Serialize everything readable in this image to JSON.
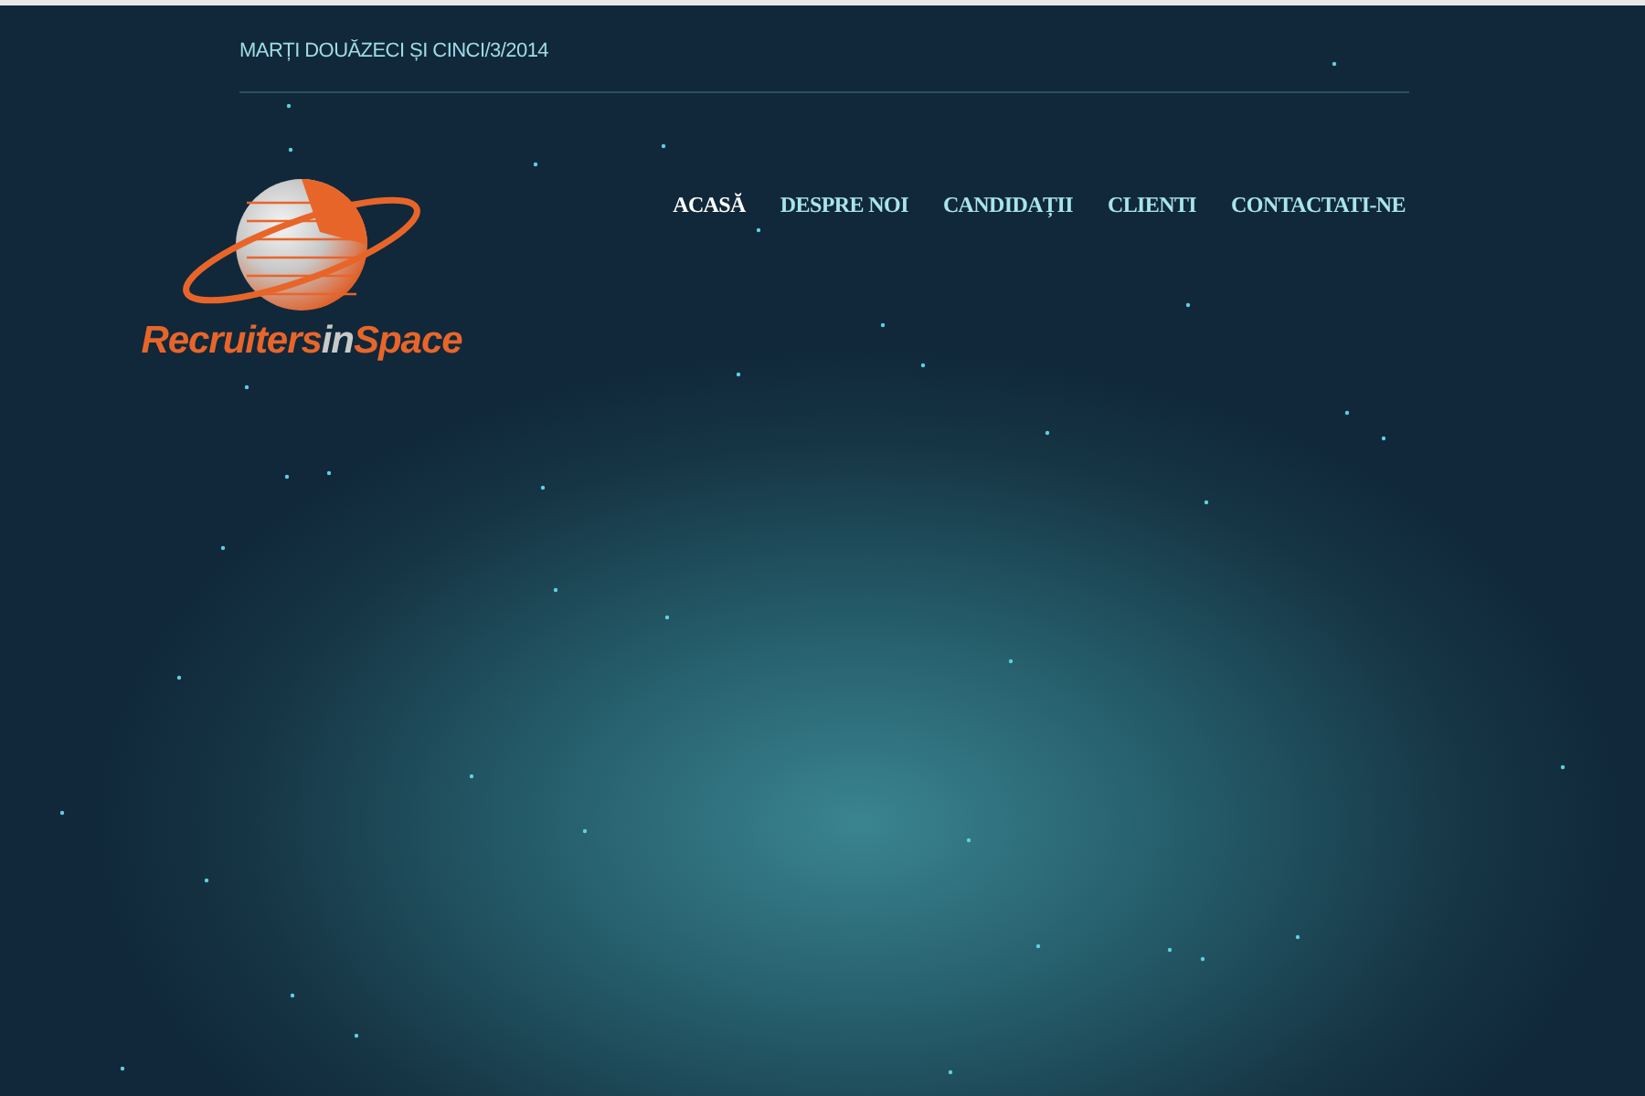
{
  "date": "MARȚI DOUĂZECI ȘI CINCI/3/2014",
  "logo": {
    "part_1": "Recruiters",
    "part_2": "in",
    "part_3": "Space"
  },
  "nav": [
    {
      "label": "ACASĂ",
      "selected": true
    },
    {
      "label": "DESPRE NOI",
      "selected": false
    },
    {
      "label": "CANDIDAȚII",
      "selected": false
    },
    {
      "label": "CLIENTI",
      "selected": false
    },
    {
      "label": "CONTACTATI-NE",
      "selected": false
    }
  ]
}
